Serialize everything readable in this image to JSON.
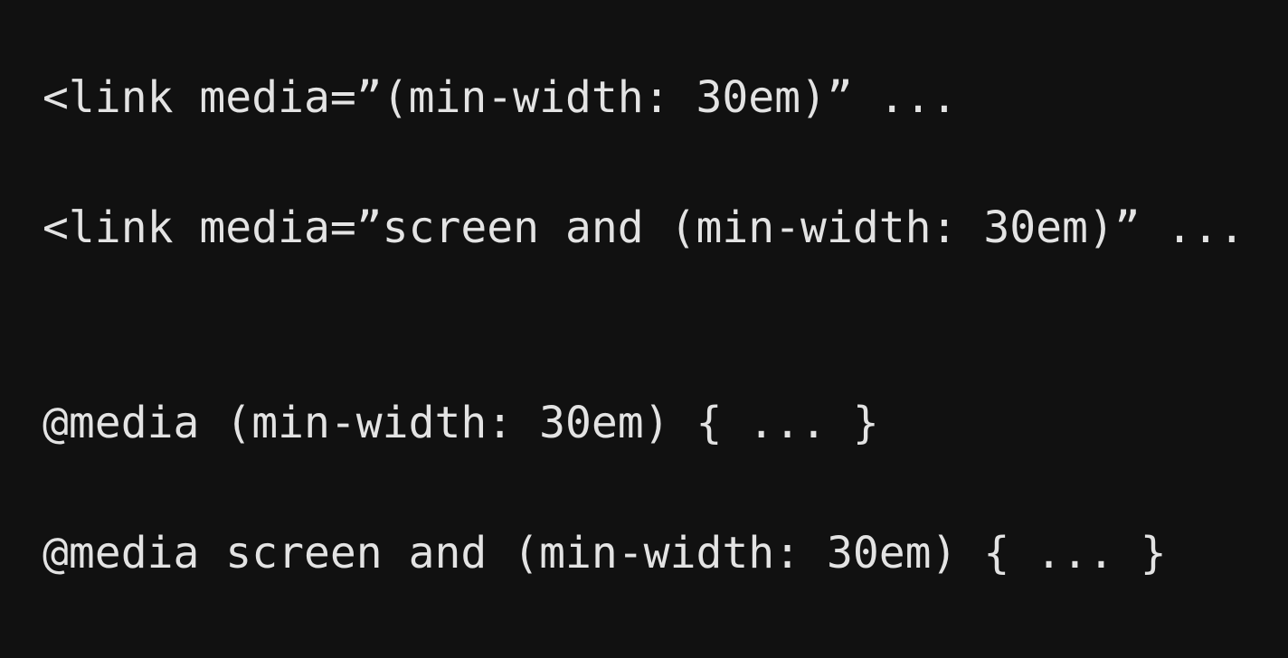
{
  "slide": {
    "lines": [
      "<link media=”(min-width: 30em)” ...",
      "<link media=”screen and (min-width: 30em)” ...",
      "@media (min-width: 30em) { ... }",
      "@media screen and (min-width: 30em) { ... }"
    ],
    "colors": {
      "background": "#111111",
      "text": "#e3e3e3"
    }
  }
}
